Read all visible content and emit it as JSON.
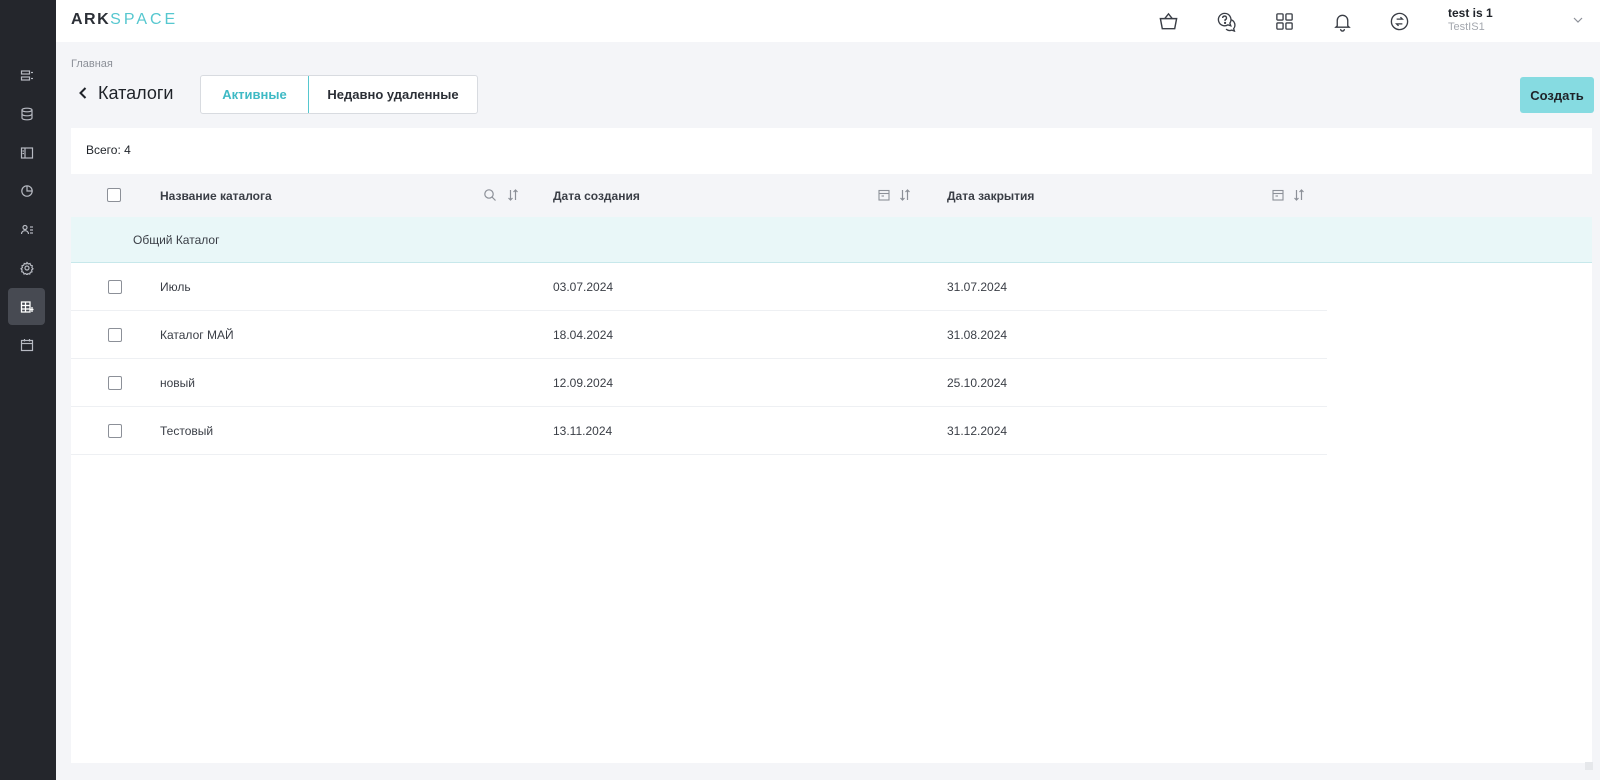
{
  "header": {
    "logo_main": "ARK",
    "logo_accent": "SPACE",
    "icons": [
      "basket-icon",
      "help-chat-icon",
      "apps-grid-icon",
      "bell-icon",
      "sync-icon"
    ],
    "user_name": "test is 1",
    "user_sub": "TestIS1"
  },
  "sidebar": {
    "items": [
      {
        "icon": "list-icon",
        "active": false
      },
      {
        "icon": "database-icon",
        "active": false
      },
      {
        "icon": "panel-icon",
        "active": false
      },
      {
        "icon": "chart-icon",
        "active": false
      },
      {
        "icon": "users-icon",
        "active": false
      },
      {
        "icon": "gear-icon",
        "active": false
      },
      {
        "icon": "catalog-icon",
        "active": true
      },
      {
        "icon": "calendar-icon",
        "active": false
      }
    ]
  },
  "page": {
    "breadcrumb": "Главная",
    "title": "Каталоги",
    "tabs": [
      {
        "label": "Активные",
        "active": true
      },
      {
        "label": "Недавно удаленные",
        "active": false
      }
    ],
    "create_label": "Создать"
  },
  "table": {
    "total": "Всего: 4",
    "columns": [
      "Название каталога",
      "Дата создания",
      "Дата закрытия"
    ],
    "group_label": "Общий Каталог",
    "rows": [
      [
        "Июль",
        "03.07.2024",
        "31.07.2024"
      ],
      [
        "Каталог МАЙ",
        "18.04.2024",
        "31.08.2024"
      ],
      [
        "новый",
        "12.09.2024",
        "25.10.2024"
      ],
      [
        "Тестовый",
        "13.11.2024",
        "31.12.2024"
      ]
    ]
  },
  "colors": {
    "accent": "#56c7cf",
    "create_button": "#86dbe1",
    "sidebar_bg": "#24262c",
    "group_row_bg": "#e9f7f8"
  }
}
